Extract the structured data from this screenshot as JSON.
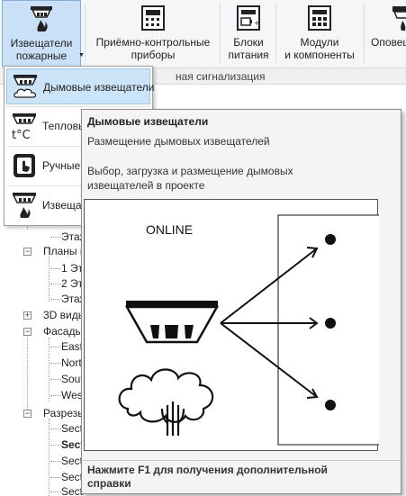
{
  "ribbon": {
    "buttons": [
      {
        "label": "Извещатели\nпожарные",
        "icon": "fire-detector-icon"
      },
      {
        "label": "Приёмно-контрольные\nприборы",
        "icon": "control-panel-icon"
      },
      {
        "label": "Блоки\nпитания",
        "icon": "power-supply-icon"
      },
      {
        "label": "Модули\nи компоненты",
        "icon": "modules-icon"
      },
      {
        "label": "Оповещ",
        "icon": "alert-icon"
      }
    ],
    "group_label": "ная сигнализация"
  },
  "dropdown": {
    "items": [
      {
        "label": "Дымовые извещатели",
        "icon": "smoke-detector-icon"
      },
      {
        "label": "Тепловы",
        "icon": "heat-detector-icon"
      },
      {
        "label": "Ручные",
        "icon": "manual-call-point-icon"
      },
      {
        "label": "Извещат",
        "icon": "flame-detector-icon"
      }
    ]
  },
  "tooltip": {
    "title": "Дымовые извещатели",
    "subtitle": "Размещение дымовых извещателей",
    "description": "Выбор, загрузка и размещение дымовых извещателей в проекте",
    "image_text": "ONLINE",
    "footer": "Нажмите F1 для получения дополнительной справки"
  },
  "tree": {
    "items": [
      {
        "label": "Этаж"
      },
      {
        "label": "Планы п"
      },
      {
        "label": "1 Эт"
      },
      {
        "label": "2 Эт"
      },
      {
        "label": "Этаж"
      },
      {
        "label": "3D виды"
      },
      {
        "label": "Фасады"
      },
      {
        "label": "East"
      },
      {
        "label": "Nort"
      },
      {
        "label": "Sout"
      },
      {
        "label": "West"
      },
      {
        "label": "Разрезы"
      },
      {
        "label": "Sect"
      },
      {
        "label": "Sect"
      },
      {
        "label": "Sect"
      },
      {
        "label": "Sect"
      },
      {
        "label": "Sect"
      }
    ]
  }
}
